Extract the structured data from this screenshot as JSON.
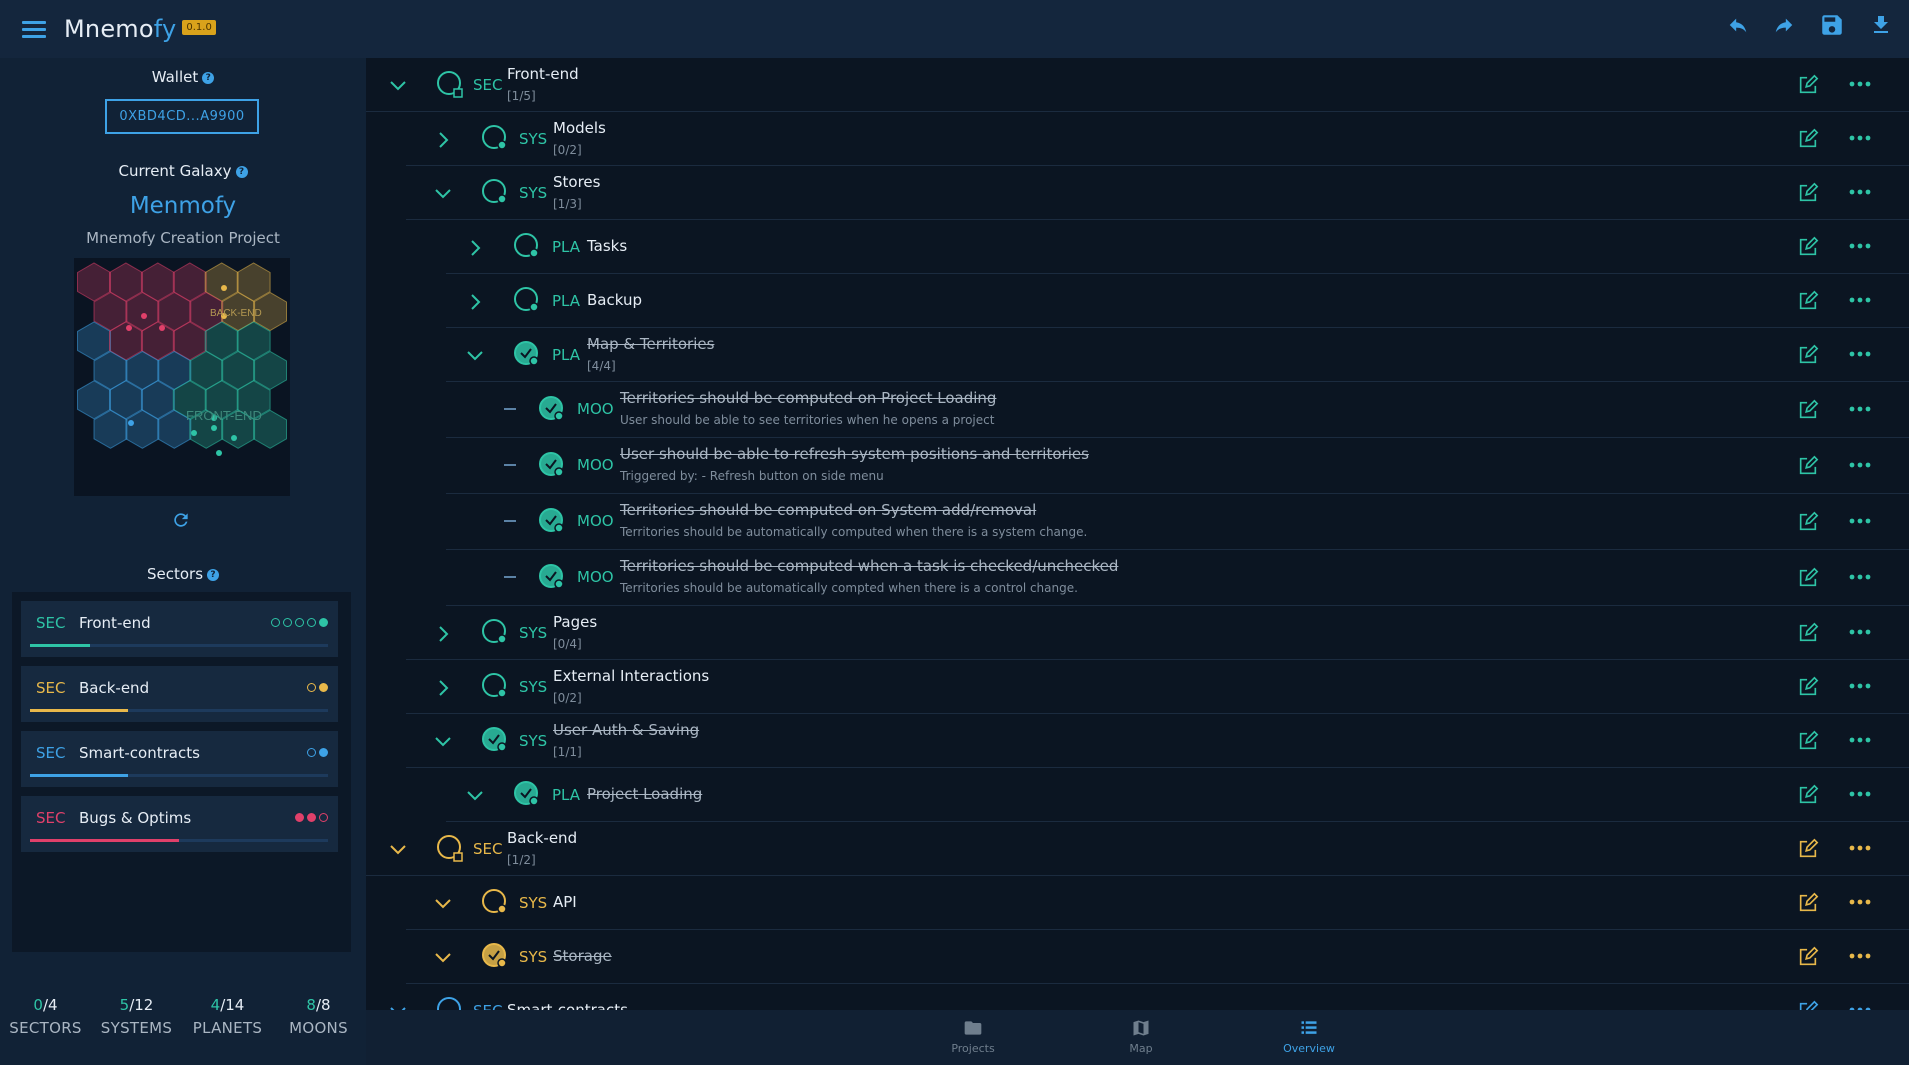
{
  "app": {
    "name_main": "Mnemo",
    "name_accent": "fy",
    "version": "0.1.0"
  },
  "toolbar": {
    "icons": [
      "undo-icon",
      "redo-icon",
      "save-icon",
      "download-icon"
    ]
  },
  "sidebar": {
    "wallet_label": "Wallet",
    "wallet_address": "0XBD4CD...A9900",
    "current_galaxy_label": "Current Galaxy",
    "galaxy_name": "Menmofy",
    "galaxy_description": "Mnemofy Creation Project",
    "map_labels": [
      "BACK-END",
      "FRONT-END"
    ],
    "sectors_label": "Sectors",
    "sectors": [
      {
        "tag": "SEC",
        "name": "Front-end",
        "color": "#2ec4a6",
        "dots": [
          false,
          false,
          false,
          false,
          true
        ],
        "progress": 0.2
      },
      {
        "tag": "SEC",
        "name": "Back-end",
        "color": "#e8b84a",
        "dots": [
          false,
          true
        ],
        "progress": 0.33
      },
      {
        "tag": "SEC",
        "name": "Smart-contracts",
        "color": "#3ea2e6",
        "dots": [
          false,
          true
        ],
        "progress": 0.33
      },
      {
        "tag": "SEC",
        "name": "Bugs & Optims",
        "color": "#e0406a",
        "dots": [
          true,
          true,
          false
        ],
        "progress": 0.5
      }
    ],
    "stats": [
      {
        "done": "0",
        "total": "/4",
        "label": "SECTORS"
      },
      {
        "done": "5",
        "total": "/12",
        "label": "SYSTEMS"
      },
      {
        "done": "4",
        "total": "/14",
        "label": "PLANETS"
      },
      {
        "done": "8",
        "total": "/8",
        "label": "MOONS"
      }
    ]
  },
  "tree": [
    {
      "level": 0,
      "expander": "open",
      "type": "SEC",
      "title": "Front-end",
      "sub": "[1/5]",
      "done": false,
      "color": "#2ec4a6"
    },
    {
      "level": 1,
      "expander": "closed",
      "type": "SYS",
      "title": "Models",
      "sub": "[0/2]",
      "done": false,
      "color": "#2ec4a6"
    },
    {
      "level": 1,
      "expander": "open",
      "type": "SYS",
      "title": "Stores",
      "sub": "[1/3]",
      "done": false,
      "color": "#2ec4a6"
    },
    {
      "level": 2,
      "expander": "closed",
      "type": "PLA",
      "title": "Tasks",
      "sub": "",
      "done": false,
      "color": "#2ec4a6"
    },
    {
      "level": 2,
      "expander": "closed",
      "type": "PLA",
      "title": "Backup",
      "sub": "",
      "done": false,
      "color": "#2ec4a6"
    },
    {
      "level": 2,
      "expander": "open",
      "type": "PLA",
      "title": "Map & Territories",
      "sub": "[4/4]",
      "done": true,
      "color": "#2ec4a6"
    },
    {
      "level": 3,
      "expander": "dash",
      "type": "MOO",
      "title": "Territories should be computed on Project Loading",
      "sub": "User should be able to see territories when he opens a project",
      "done": true,
      "color": "#2ec4a6"
    },
    {
      "level": 3,
      "expander": "dash",
      "type": "MOO",
      "title": "User should be able to refresh system positions and territories",
      "sub": "Triggered by: - Refresh button on side menu",
      "done": true,
      "color": "#2ec4a6"
    },
    {
      "level": 3,
      "expander": "dash",
      "type": "MOO",
      "title": "Territories should be computed on System add/removal",
      "sub": "Territories should be automatically computed when there is a system change.",
      "done": true,
      "color": "#2ec4a6"
    },
    {
      "level": 3,
      "expander": "dash",
      "type": "MOO",
      "title": "Territories should be computed when a task is checked/unchecked",
      "sub": "Territories should be automatically compted when there is a control change.",
      "done": true,
      "color": "#2ec4a6"
    },
    {
      "level": 1,
      "expander": "closed",
      "type": "SYS",
      "title": "Pages",
      "sub": "[0/4]",
      "done": false,
      "color": "#2ec4a6"
    },
    {
      "level": 1,
      "expander": "closed",
      "type": "SYS",
      "title": "External Interactions",
      "sub": "[0/2]",
      "done": false,
      "color": "#2ec4a6"
    },
    {
      "level": 1,
      "expander": "open",
      "type": "SYS",
      "title": "User Auth & Saving",
      "sub": "[1/1]",
      "done": true,
      "color": "#2ec4a6"
    },
    {
      "level": 2,
      "expander": "open",
      "type": "PLA",
      "title": "Project Loading",
      "sub": "",
      "done": true,
      "color": "#2ec4a6"
    },
    {
      "level": 0,
      "expander": "open",
      "type": "SEC",
      "title": "Back-end",
      "sub": "[1/2]",
      "done": false,
      "color": "#e8b84a"
    },
    {
      "level": 1,
      "expander": "open",
      "type": "SYS",
      "title": "API",
      "sub": "",
      "done": false,
      "color": "#e8b84a"
    },
    {
      "level": 1,
      "expander": "open",
      "type": "SYS",
      "title": "Storage",
      "sub": "",
      "done": true,
      "color": "#e8b84a"
    },
    {
      "level": 0,
      "expander": "open",
      "type": "SEC",
      "title": "Smart-contracts",
      "sub": "",
      "done": false,
      "color": "#3ea2e6"
    }
  ],
  "bottom_nav": [
    {
      "label": "Projects",
      "icon": "folder-icon",
      "active": false
    },
    {
      "label": "Map",
      "icon": "map-icon",
      "active": false
    },
    {
      "label": "Overview",
      "icon": "list-icon",
      "active": true
    }
  ]
}
